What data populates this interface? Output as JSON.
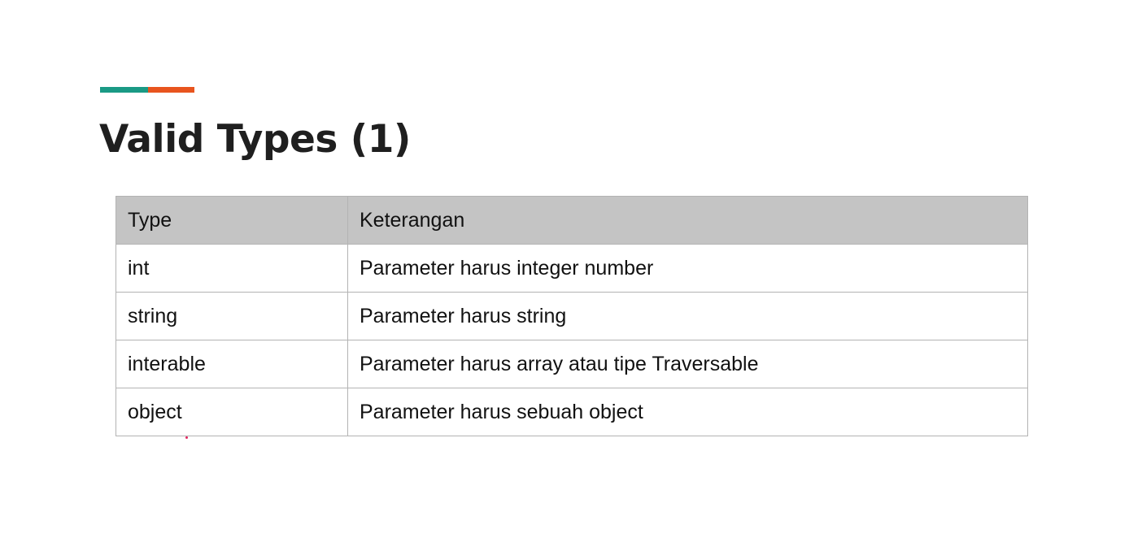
{
  "accent": {
    "colors": [
      "#1a9a85",
      "#e8541e"
    ]
  },
  "slide": {
    "title": "Valid Types (1)"
  },
  "table": {
    "headers": [
      "Type",
      "Keterangan"
    ],
    "rows": [
      [
        "int",
        "Parameter harus integer number"
      ],
      [
        "string",
        "Parameter harus string"
      ],
      [
        "interable",
        "Parameter harus array atau tipe Traversable"
      ],
      [
        "object",
        "Parameter harus sebuah object"
      ]
    ]
  },
  "colors": {
    "header_bg": "#c4c4c4",
    "border": "#b3b3b3",
    "title": "#1f1f1f"
  }
}
